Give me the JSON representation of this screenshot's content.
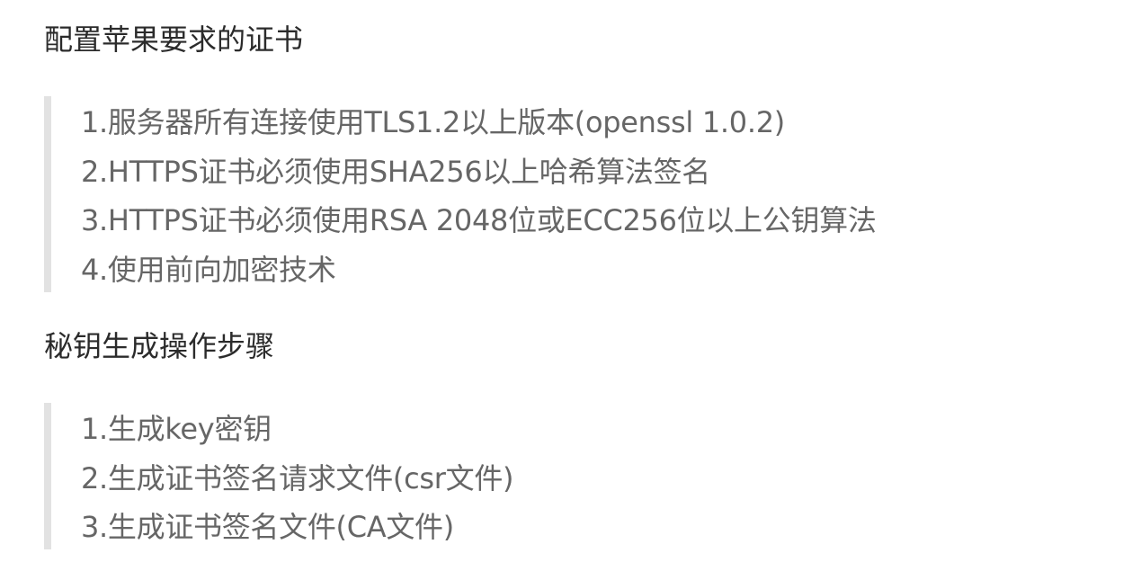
{
  "sections": [
    {
      "title": "配置苹果要求的证书",
      "items": [
        "1.服务器所有连接使用TLS1.2以上版本(openssl 1.0.2)",
        "2.HTTPS证书必须使用SHA256以上哈希算法签名",
        "3.HTTPS证书必须使用RSA 2048位或ECC256位以上公钥算法",
        "4.使用前向加密技术"
      ]
    },
    {
      "title": "秘钥生成操作步骤",
      "items": [
        "1.生成key密钥",
        "2.生成证书签名请求文件(csr文件)",
        "3.生成证书签名文件(CA文件)"
      ]
    }
  ],
  "colors": {
    "heading": "#2b2b2b",
    "quote_text": "#666666",
    "quote_bar": "#e2e2e2",
    "background": "#ffffff"
  }
}
